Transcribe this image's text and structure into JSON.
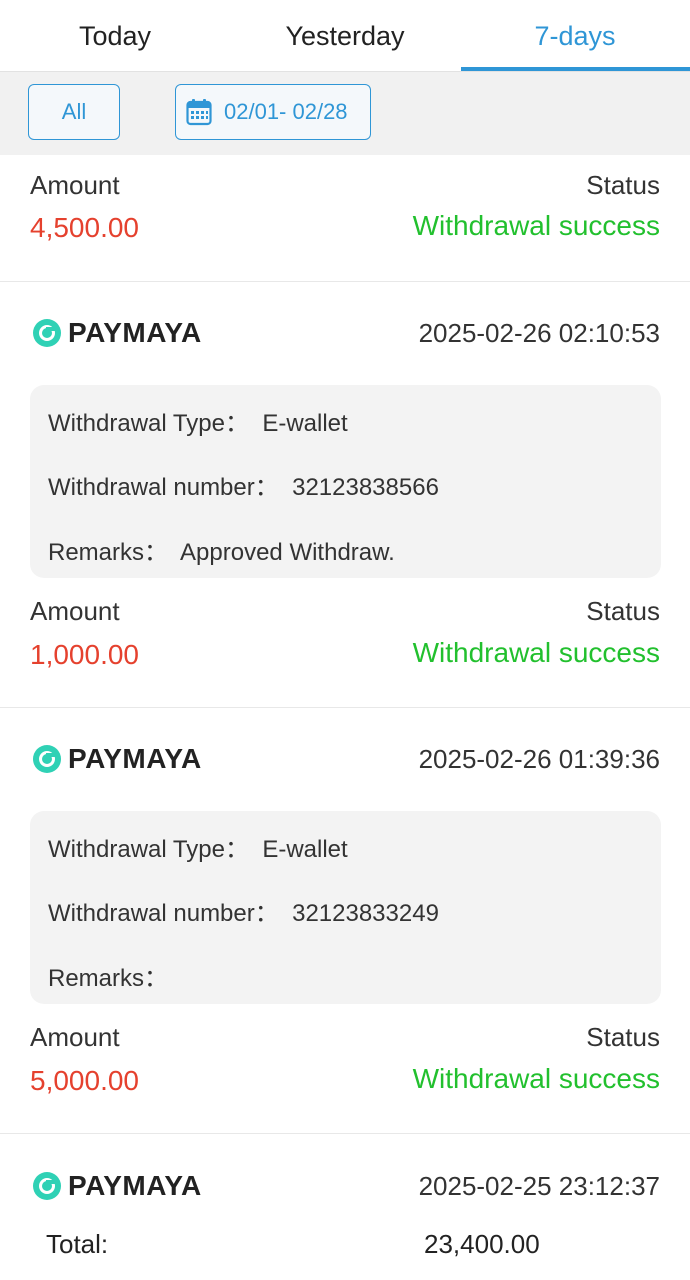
{
  "tabs": [
    {
      "label": "Today",
      "active": false
    },
    {
      "label": "Yesterday",
      "active": false
    },
    {
      "label": "7-days",
      "active": true
    }
  ],
  "filters": {
    "all_label": "All",
    "date_range": "02/01- 02/28",
    "date_icon": "calendar-icon"
  },
  "labels": {
    "amount": "Amount",
    "status": "Status",
    "withdrawal_type": "Withdrawal Type：",
    "withdrawal_number": "Withdrawal number：",
    "remarks": "Remarks："
  },
  "top_partial": {
    "amount": "4,500.00",
    "status": "Withdrawal success"
  },
  "records": [
    {
      "provider": "PAYMAYA",
      "provider_icon": "paymaya-logo-icon",
      "datetime": "2025-02-26 02:10:53",
      "withdrawal_type": "E-wallet",
      "withdrawal_number": "32123838566",
      "remarks": "Approved Withdraw.",
      "amount": "1,000.00",
      "status": "Withdrawal success"
    },
    {
      "provider": "PAYMAYA",
      "provider_icon": "paymaya-logo-icon",
      "datetime": "2025-02-26 01:39:36",
      "withdrawal_type": "E-wallet",
      "withdrawal_number": "32123833249",
      "remarks": "",
      "amount": "5,000.00",
      "status": "Withdrawal success"
    },
    {
      "provider": "PAYMAYA",
      "provider_icon": "paymaya-logo-icon",
      "datetime": "2025-02-25 23:12:37"
    }
  ],
  "total": {
    "label": "Total:",
    "value": "23,400.00"
  },
  "colors": {
    "accent": "#2f96d6",
    "amount": "#e5412e",
    "status_success": "#22c02e",
    "logo": "#2fd1b5"
  }
}
